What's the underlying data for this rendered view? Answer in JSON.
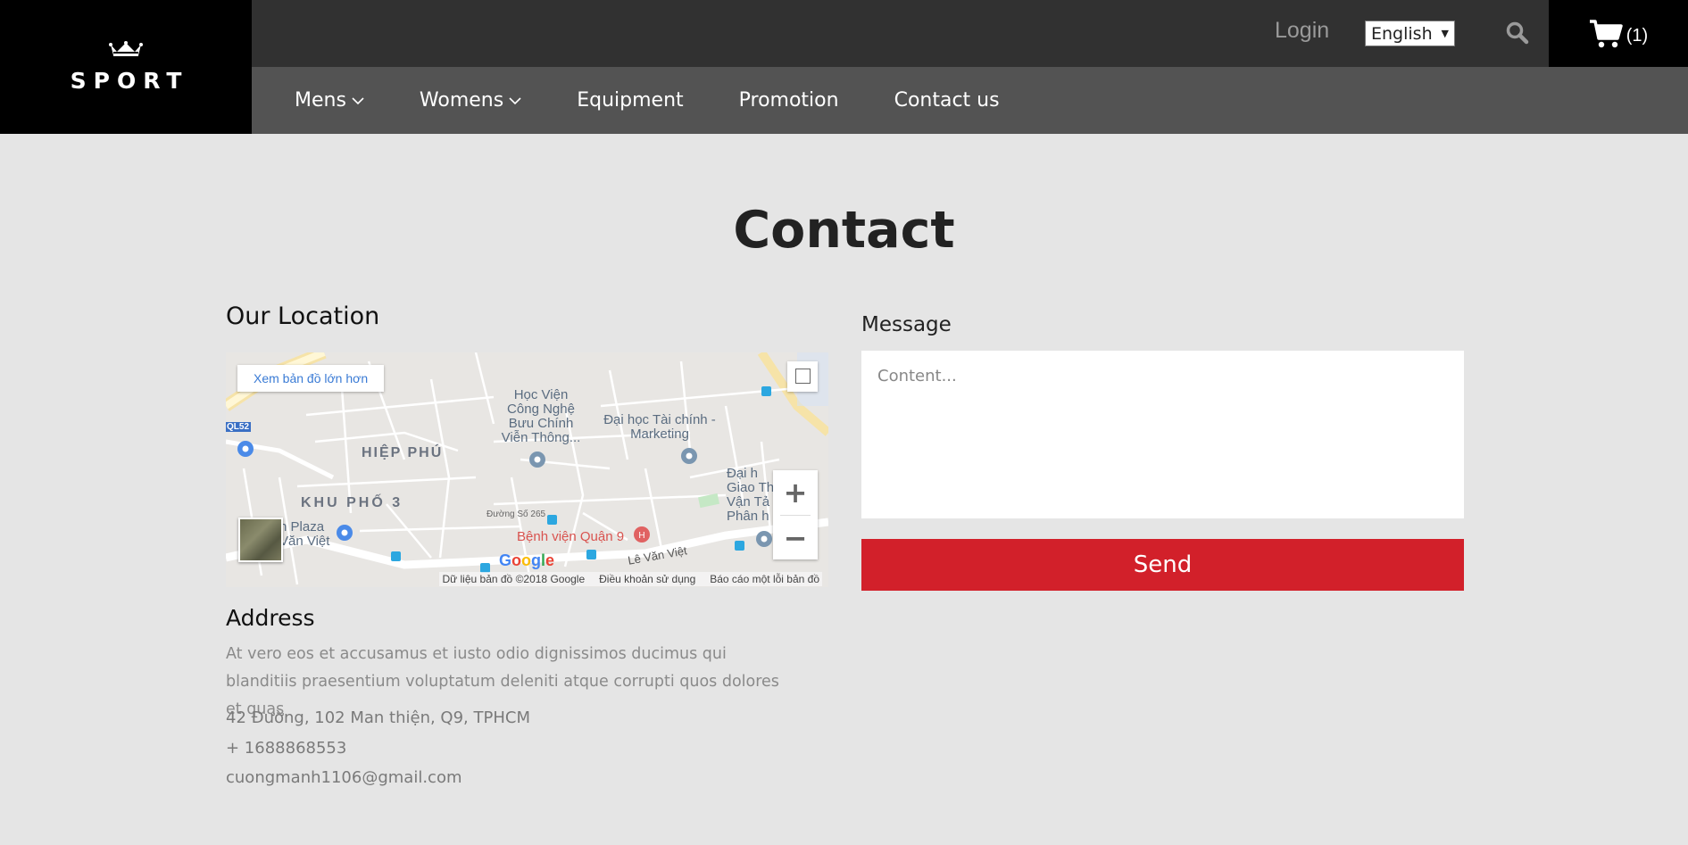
{
  "header": {
    "logo_text": "SPORT",
    "login_label": "Login",
    "language_selected": "English",
    "cart_count": "(1)"
  },
  "nav": {
    "items": [
      {
        "label": "Mens",
        "has_dropdown": true
      },
      {
        "label": "Womens",
        "has_dropdown": true
      },
      {
        "label": "Equipment",
        "has_dropdown": false
      },
      {
        "label": "Promotion",
        "has_dropdown": false
      },
      {
        "label": "Contact us",
        "has_dropdown": false
      }
    ]
  },
  "main": {
    "title": "Contact",
    "location_title": "Our Location",
    "map": {
      "larger_map_link": "Xem bản đồ lớn hơn",
      "labels": [
        "HIỆP PHÚ",
        "KHU PHỐ 3",
        "Học Viện Công Nghệ Bưu Chính Viễn Thông...",
        "Đại học Tài chính - Marketing",
        "Bệnh viện Quận 9",
        "Lê Văn Việt",
        "Đường Số 265",
        "QL52",
        "Đại h Giao Th Vận Tả Phân h",
        "n Plaza Văn Việt"
      ],
      "attribution": "Dữ liệu bản đồ ©2018 Google",
      "terms": "Điều khoản sử dụng",
      "report": "Báo cáo một lỗi bản đồ",
      "google_logo": "Google"
    },
    "address_title": "Address",
    "address_desc": "At vero eos et accusamus et iusto odio dignissimos ducimus qui blanditiis praesentium voluptatum deleniti atque corrupti quos dolores et quas",
    "address_line": "42 Đường, 102 Man thiện, Q9, TPHCM",
    "phone": "+ 1688868553",
    "email": "cuongmanh1106@gmail.com",
    "message_title": "Message",
    "message_placeholder": "Content...",
    "send_label": "Send"
  },
  "colors": {
    "accent_red": "#d2202a",
    "header_dark": "#313131",
    "nav_gray": "#535353",
    "page_bg": "#e5e5e5"
  }
}
